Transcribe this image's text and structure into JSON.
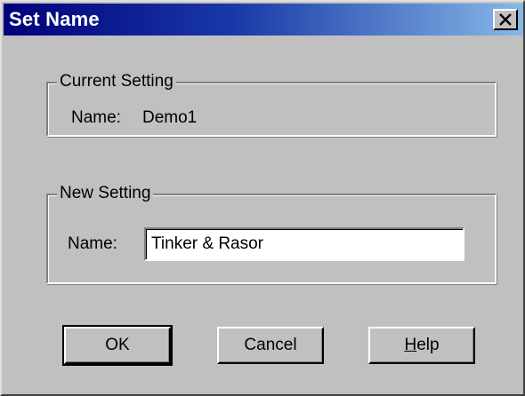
{
  "window": {
    "title": "Set Name",
    "close_label": "Close"
  },
  "current_setting": {
    "legend": "Current Setting",
    "name_label": "Name:",
    "name_value": "Demo1"
  },
  "new_setting": {
    "legend": "New Setting",
    "name_label": "Name:",
    "name_input_value": "Tinker & Rasor"
  },
  "buttons": {
    "ok_label": "OK",
    "cancel_label": "Cancel",
    "help_mnemonic": "H",
    "help_rest": "elp"
  },
  "colors": {
    "titlebar_start": "#00007b",
    "titlebar_end": "#86b8e8",
    "dialog_face": "#c0c0c0"
  }
}
